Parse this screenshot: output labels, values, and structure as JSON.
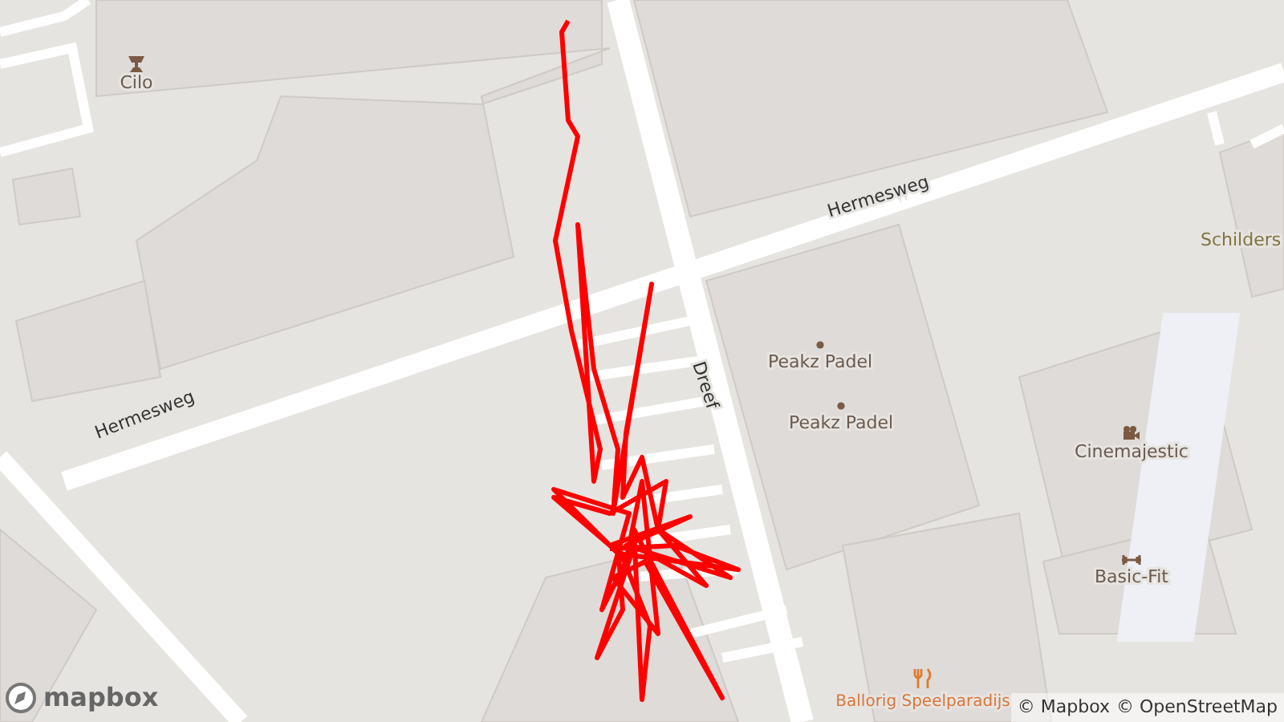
{
  "map": {
    "labels": [
      {
        "kind": "poi",
        "text": "Cilo"
      },
      {
        "kind": "street",
        "text": "Hermesweg"
      },
      {
        "kind": "area",
        "text": "Schilders"
      },
      {
        "kind": "street",
        "text": "Dreef"
      },
      {
        "kind": "poi",
        "text": "Peakz Padel"
      },
      {
        "kind": "poi",
        "text": "Peakz Padel"
      },
      {
        "kind": "poi",
        "text": "Cinemajestic"
      },
      {
        "kind": "street",
        "text": "Hermesweg"
      },
      {
        "kind": "poi",
        "text": "Basic-Fit"
      },
      {
        "kind": "poi",
        "text": "Ballorig Speelparadijs"
      }
    ]
  },
  "logo": {
    "text": "mapbox"
  },
  "attribution": [
    "© Mapbox",
    "© OpenStreetMap"
  ]
}
